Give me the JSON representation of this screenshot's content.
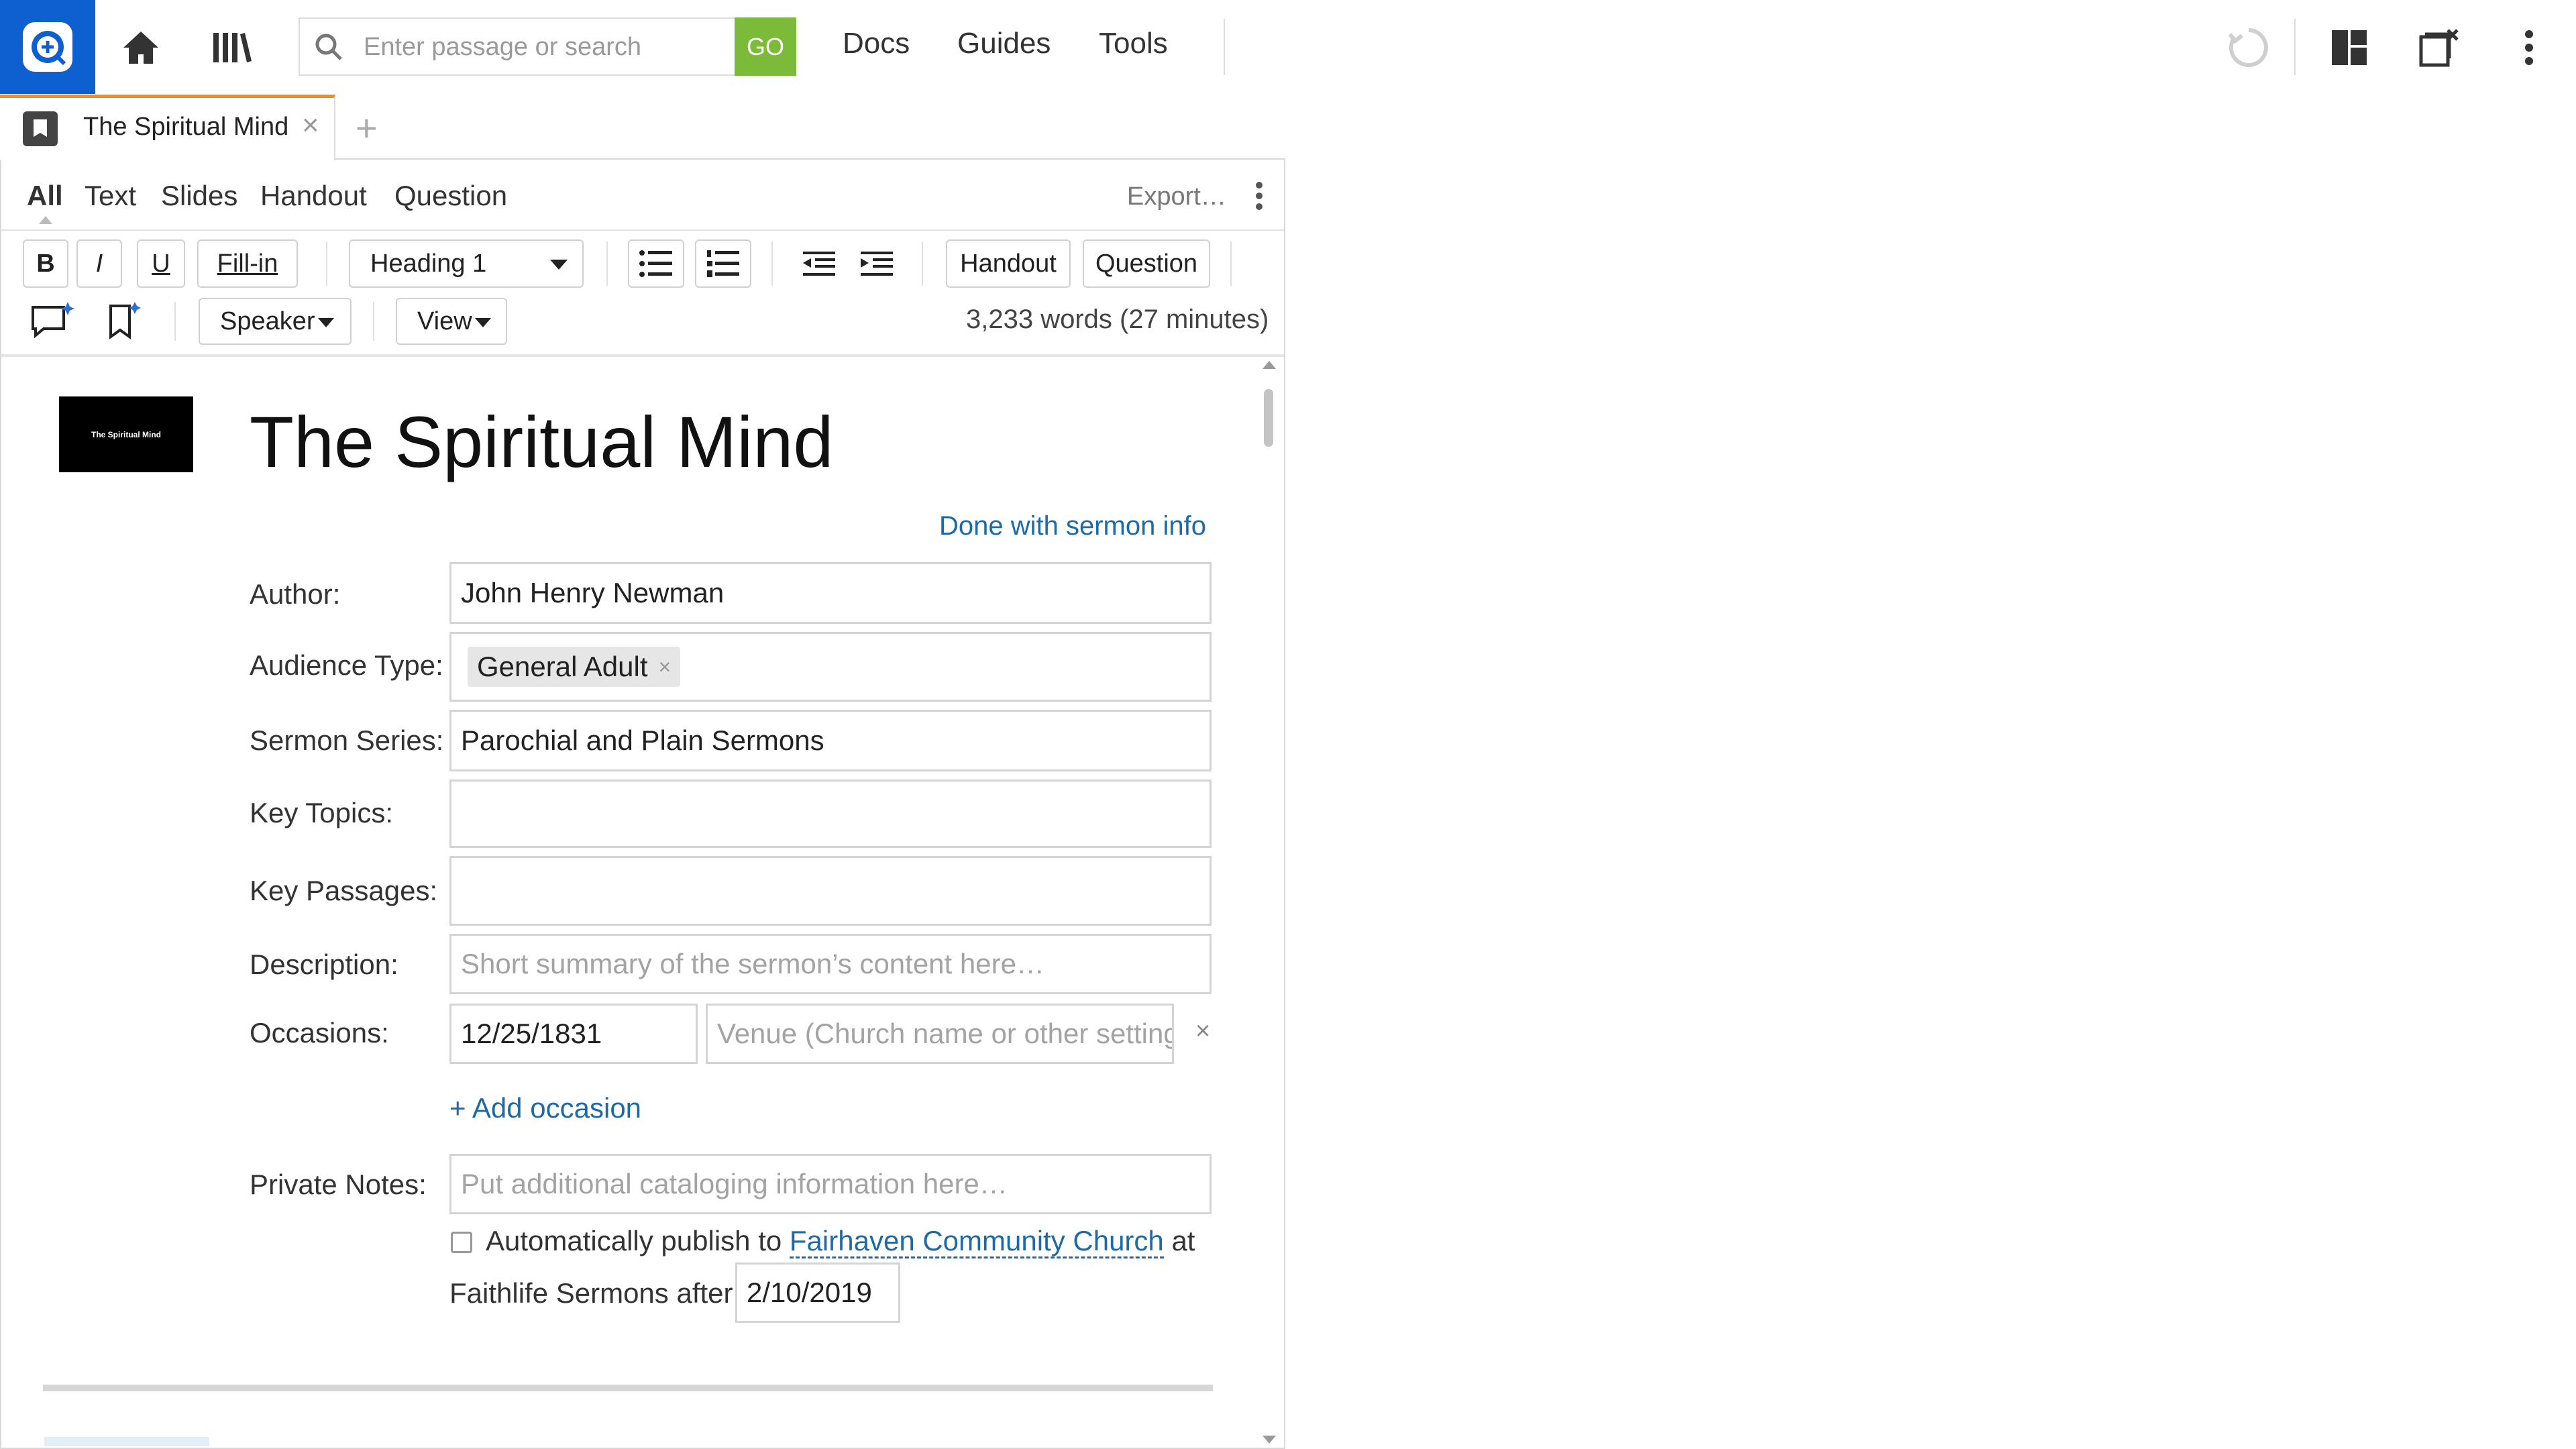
{
  "topbar": {
    "search_placeholder": "Enter passage or search",
    "go_label": "GO",
    "nav": [
      "Docs",
      "Guides",
      "Tools"
    ]
  },
  "tab": {
    "title": "The Spiritual Mind",
    "close": "×",
    "add": "+"
  },
  "modes": [
    "All",
    "Text",
    "Slides",
    "Handout",
    "Question"
  ],
  "export_label": "Export…",
  "toolbar": {
    "bold": "B",
    "italic": "I",
    "underline": "U",
    "fillin": "Fill-in",
    "style": "Heading 1",
    "handout": "Handout",
    "question": "Question",
    "speaker": "Speaker",
    "view": "View",
    "wordcount": "3,233 words (27 minutes)"
  },
  "sermon": {
    "thumb_text": "The Spiritual Mind",
    "title": "The Spiritual Mind",
    "done_link": "Done with sermon info",
    "labels": {
      "author": "Author:",
      "audience": "Audience Type:",
      "series": "Sermon Series:",
      "topics": "Key Topics:",
      "passages": "Key Passages:",
      "description": "Description:",
      "occasions": "Occasions:",
      "notes": "Private Notes:"
    },
    "author": "John Henry Newman",
    "audience_tag": "General Adult",
    "series": "Parochial and Plain Sermons",
    "description_placeholder": "Short summary of the sermon’s content here…",
    "occasion_date": "12/25/1831",
    "venue_placeholder": "Venue (Church name or other setting)",
    "add_occasion": "+ Add occasion",
    "notes_placeholder": "Put additional cataloging information here…",
    "publish_prefix": "Automatically publish to",
    "publish_church": "Fairhaven Community Church",
    "publish_at": "at",
    "publish_line2": "Faithlife Sermons after",
    "publish_date": "2/10/2019"
  },
  "colors": {
    "brand": "#0e5fcf",
    "go": "#7cbb3a",
    "tab_accent": "#f28c28",
    "link": "#1f6aa5"
  }
}
